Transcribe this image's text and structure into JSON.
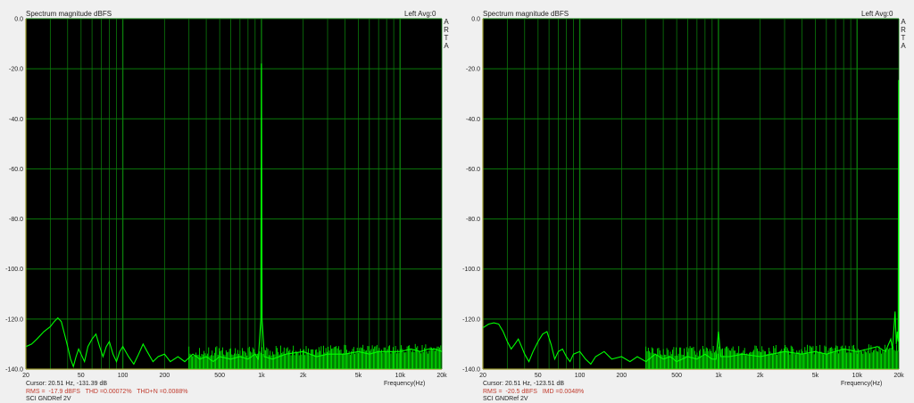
{
  "colors": {
    "plot_bg": "#000000",
    "trace": "#00ff00",
    "grid": "#0b7a0b",
    "stats_text": "#c0392b"
  },
  "panels": [
    {
      "title": "Spectrum magnitude dBFS",
      "channel": "Left  Avg:0",
      "brand": "ARTA",
      "xlabel": "Frequency(Hz)",
      "cursor": "Cursor: 20.51 Hz, -131.39 dB",
      "stats": "RMS =  -17.9 dBFS   THD =0.00072%   THD+N =0.0088%",
      "measurement": "SCI GNDRef 2V"
    },
    {
      "title": "Spectrum magnitude dBFS",
      "channel": "Left  Avg:0",
      "brand": "ARTA",
      "xlabel": "Frequency(Hz)",
      "cursor": "Cursor: 20.51 Hz, -123.51 dB",
      "stats": "RMS =  -20.5 dBFS   IMD =0.0048%",
      "measurement": "SCI GNDRef 2V"
    }
  ],
  "chart_data": [
    {
      "type": "line",
      "title": "Spectrum magnitude dBFS",
      "xlabel": "Frequency(Hz)",
      "ylabel": "",
      "xscale": "log",
      "xlim": [
        20,
        20000
      ],
      "ylim": [
        -140,
        0
      ],
      "grid": true,
      "yticks": [
        "0.0",
        "-20.0",
        "-40.0",
        "-60.0",
        "-80.0",
        "-100.0",
        "-120.0",
        "-140.0"
      ],
      "xticks": [
        {
          "f": 20,
          "label": "20"
        },
        {
          "f": 50,
          "label": "50"
        },
        {
          "f": 100,
          "label": "100"
        },
        {
          "f": 200,
          "label": "200"
        },
        {
          "f": 500,
          "label": "500"
        },
        {
          "f": 1000,
          "label": "1k"
        },
        {
          "f": 2000,
          "label": "2k"
        },
        {
          "f": 5000,
          "label": "5k"
        },
        {
          "f": 10000,
          "label": "10k"
        },
        {
          "f": 20000,
          "label": "20k"
        }
      ],
      "series": [
        {
          "points": [
            [
              20,
              -131
            ],
            [
              22,
              -130
            ],
            [
              24,
              -128
            ],
            [
              27,
              -125
            ],
            [
              30,
              -123
            ],
            [
              32,
              -121
            ],
            [
              34,
              -119.5
            ],
            [
              36,
              -121
            ],
            [
              38,
              -126
            ],
            [
              40,
              -131
            ],
            [
              42,
              -136
            ],
            [
              44,
              -139
            ],
            [
              46,
              -135
            ],
            [
              48,
              -132
            ],
            [
              50,
              -134
            ],
            [
              53,
              -137
            ],
            [
              56,
              -131
            ],
            [
              60,
              -128
            ],
            [
              64,
              -126
            ],
            [
              68,
              -131
            ],
            [
              72,
              -135
            ],
            [
              76,
              -131
            ],
            [
              80,
              -129
            ],
            [
              85,
              -134
            ],
            [
              90,
              -137
            ],
            [
              95,
              -133
            ],
            [
              100,
              -131
            ],
            [
              110,
              -135
            ],
            [
              120,
              -138
            ],
            [
              130,
              -134
            ],
            [
              140,
              -130
            ],
            [
              150,
              -133
            ],
            [
              165,
              -137
            ],
            [
              180,
              -135
            ],
            [
              200,
              -134
            ],
            [
              220,
              -137
            ],
            [
              250,
              -135
            ],
            [
              280,
              -137
            ],
            [
              320,
              -134
            ],
            [
              360,
              -136
            ],
            [
              400,
              -135
            ],
            [
              450,
              -137
            ],
            [
              500,
              -135
            ],
            [
              600,
              -136
            ],
            [
              700,
              -135
            ],
            [
              800,
              -136
            ],
            [
              900,
              -134
            ],
            [
              950,
              -136
            ],
            [
              990,
              -120
            ],
            [
              1000,
              -17.9
            ],
            [
              1010,
              -120
            ],
            [
              1050,
              -135
            ],
            [
              1200,
              -136
            ],
            [
              1500,
              -134
            ],
            [
              2000,
              -133
            ],
            [
              2500,
              -135
            ],
            [
              3000,
              -134
            ],
            [
              4000,
              -134
            ],
            [
              5000,
              -133
            ],
            [
              6000,
              -134
            ],
            [
              7000,
              -133
            ],
            [
              8000,
              -133
            ],
            [
              10000,
              -133
            ],
            [
              12000,
              -132
            ],
            [
              14000,
              -133
            ],
            [
              16000,
              -132
            ],
            [
              18000,
              -132
            ],
            [
              20000,
              -133
            ]
          ]
        }
      ]
    },
    {
      "type": "line",
      "title": "Spectrum magnitude dBFS",
      "xlabel": "Frequency(Hz)",
      "ylabel": "",
      "xscale": "log",
      "xlim": [
        20,
        20000
      ],
      "ylim": [
        -140,
        0
      ],
      "grid": true,
      "yticks": [
        "0.0",
        "-20.0",
        "-40.0",
        "-60.0",
        "-80.0",
        "-100.0",
        "-120.0",
        "-140.0"
      ],
      "xticks": [
        {
          "f": 20,
          "label": "20"
        },
        {
          "f": 50,
          "label": "50"
        },
        {
          "f": 100,
          "label": "100"
        },
        {
          "f": 200,
          "label": "200"
        },
        {
          "f": 500,
          "label": "500"
        },
        {
          "f": 1000,
          "label": "1k"
        },
        {
          "f": 2000,
          "label": "2k"
        },
        {
          "f": 5000,
          "label": "5k"
        },
        {
          "f": 10000,
          "label": "10k"
        },
        {
          "f": 20000,
          "label": "20k"
        }
      ],
      "series": [
        {
          "points": [
            [
              20,
              -123.5
            ],
            [
              22,
              -122
            ],
            [
              24,
              -121.5
            ],
            [
              26,
              -122
            ],
            [
              28,
              -125
            ],
            [
              30,
              -129
            ],
            [
              32,
              -132
            ],
            [
              34,
              -130
            ],
            [
              36,
              -128
            ],
            [
              38,
              -131
            ],
            [
              40,
              -134
            ],
            [
              43,
              -137
            ],
            [
              46,
              -133
            ],
            [
              50,
              -129
            ],
            [
              54,
              -126
            ],
            [
              58,
              -125
            ],
            [
              62,
              -130
            ],
            [
              66,
              -136
            ],
            [
              70,
              -133
            ],
            [
              75,
              -132
            ],
            [
              80,
              -135
            ],
            [
              85,
              -137
            ],
            [
              90,
              -134
            ],
            [
              100,
              -133
            ],
            [
              110,
              -136
            ],
            [
              120,
              -138
            ],
            [
              130,
              -135
            ],
            [
              150,
              -133
            ],
            [
              170,
              -136
            ],
            [
              200,
              -135
            ],
            [
              230,
              -137
            ],
            [
              260,
              -135
            ],
            [
              300,
              -137
            ],
            [
              350,
              -134
            ],
            [
              400,
              -136
            ],
            [
              450,
              -135
            ],
            [
              500,
              -137
            ],
            [
              600,
              -135
            ],
            [
              700,
              -136
            ],
            [
              800,
              -134
            ],
            [
              900,
              -136
            ],
            [
              960,
              -136
            ],
            [
              1000,
              -125
            ],
            [
              1040,
              -135
            ],
            [
              1200,
              -135
            ],
            [
              1500,
              -134
            ],
            [
              2000,
              -135
            ],
            [
              3000,
              -133
            ],
            [
              4000,
              -134
            ],
            [
              5000,
              -133
            ],
            [
              6000,
              -134
            ],
            [
              8000,
              -132
            ],
            [
              10000,
              -133
            ],
            [
              12000,
              -132
            ],
            [
              14000,
              -131
            ],
            [
              16000,
              -133
            ],
            [
              17500,
              -128
            ],
            [
              18000,
              -132
            ],
            [
              18800,
              -117
            ],
            [
              19200,
              -130
            ],
            [
              19500,
              -125
            ],
            [
              19800,
              -129
            ],
            [
              19950,
              -24.5
            ],
            [
              20000,
              -133
            ]
          ]
        }
      ]
    }
  ]
}
